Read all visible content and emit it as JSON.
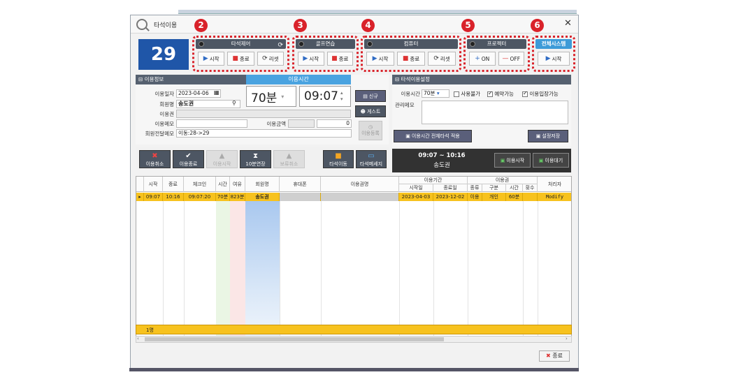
{
  "window": {
    "title": "타석이용",
    "close_icon": "✕"
  },
  "seat_number": "29",
  "groups": [
    {
      "badge": "2",
      "label": "타석제어",
      "buttons": [
        "시작",
        "종료",
        "리셋"
      ]
    },
    {
      "badge": "3",
      "label": "골프연습",
      "buttons": [
        "시작",
        "종료"
      ]
    },
    {
      "badge": "4",
      "label": "컴퓨터",
      "buttons": [
        "시작",
        "종료",
        "리셋"
      ]
    },
    {
      "badge": "5",
      "label": "프로젝터",
      "buttons": [
        "ON",
        "OFF"
      ]
    },
    {
      "badge": "6",
      "label": "전체시스템",
      "buttons": [
        "시작"
      ]
    }
  ],
  "usage_info": {
    "header": "이용정보",
    "date_label": "이용일자",
    "date_value": "2023-04-06",
    "member_label": "회원명",
    "member_value": "송도권",
    "pass_label": "이용권",
    "memo_label": "이용메모",
    "amount_label": "이용금액",
    "amount_value": "0",
    "transfer_label": "회원전달메모",
    "transfer_value": "이동:28->29",
    "time_tab": "이용시간",
    "time_minutes": "70분",
    "time_clock": "09:07",
    "new_button": "신규",
    "guest_button": "게스트",
    "register_button": "이용등록"
  },
  "toolbar": {
    "cancel": "이용취소",
    "end": "이용종료",
    "start": "이용시작",
    "extend": "10분연장",
    "hold_cancel": "보류취소",
    "move": "타석이동",
    "message": "타석메세지"
  },
  "settings": {
    "header": "타석이용설정",
    "time_label": "이용시간",
    "time_value": "70분",
    "unavailable": "사용불가",
    "reservable": "예약가능",
    "waiting": "이용입장가능",
    "memo_label": "관리메모",
    "apply_all": "이용시간 전체타석 적용",
    "save": "설정저장"
  },
  "status_bar": {
    "time_range": "09:07 ~ 10:16",
    "name": "송도권",
    "start_btn": "이용시작",
    "wait_btn": "이용대기"
  },
  "grid": {
    "headers": [
      "시작",
      "종료",
      "체크인",
      "시간",
      "여유",
      "회원명",
      "휴대폰",
      "이용권명"
    ],
    "group_period": "이용기간",
    "group_pass": "이용권",
    "period_sub": [
      "시작일",
      "종료일"
    ],
    "pass_sub": [
      "종류",
      "구분",
      "시간",
      "횟수"
    ],
    "handler": "처리자",
    "row": [
      "09:07",
      "10:16",
      "09:07:20",
      "70분",
      "823분",
      "송도권",
      "",
      "",
      "2023-04-03",
      "2023-12-02",
      "이용",
      "개인",
      "60분",
      "",
      "Modify"
    ],
    "footer_count": "1명"
  },
  "close_button": "종료"
}
